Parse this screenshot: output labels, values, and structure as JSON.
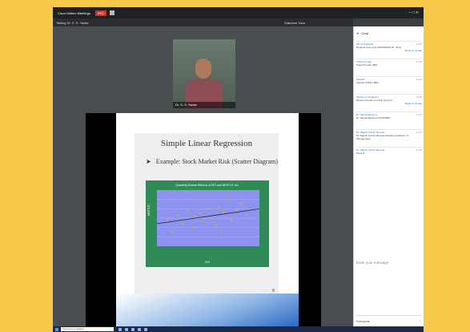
{
  "app": {
    "brand": "Cisco Webex Meetings",
    "rec_label": "REC",
    "window_controls": "– □ ✕"
  },
  "meeting": {
    "title": "Talking Dr. S. S. Yadav",
    "view_mode": "Standard View"
  },
  "video": {
    "participant_name": "Dr. S. S. Yadav"
  },
  "slide": {
    "title": "Simple Linear Regression",
    "bullet": "Example: Stock Market Risk (Scatter Diagram)",
    "page_number": "9"
  },
  "chart_data": {
    "type": "scatter",
    "title": "Quarterly Excess Returns of NYI and NESTLE, Inc.",
    "xlabel": "NYI",
    "ylabel": "NESTLE",
    "xlim": [
      -0.2,
      0.2
    ],
    "ylim": [
      -0.3,
      0.3
    ],
    "grid": true,
    "series": [
      {
        "points": [
          [
            -0.16,
            -0.02
          ],
          [
            -0.12,
            0.03
          ],
          [
            -0.1,
            -0.06
          ],
          [
            -0.08,
            0.08
          ],
          [
            -0.06,
            -0.1
          ],
          [
            -0.05,
            0.02
          ],
          [
            -0.03,
            0.05
          ],
          [
            -0.02,
            -0.04
          ],
          [
            0.0,
            0.1
          ],
          [
            0.01,
            0.0
          ],
          [
            0.03,
            -0.08
          ],
          [
            0.04,
            0.12
          ],
          [
            0.06,
            0.06
          ],
          [
            0.07,
            0.2
          ],
          [
            0.09,
            -0.02
          ],
          [
            0.11,
            0.09
          ],
          [
            0.13,
            0.16
          ],
          [
            0.15,
            0.04
          ],
          [
            -0.14,
            -0.14
          ],
          [
            0.05,
            -0.16
          ]
        ]
      }
    ],
    "trendline": {
      "x": [
        -0.2,
        0.2
      ],
      "y": [
        -0.06,
        0.1
      ]
    }
  },
  "chat": {
    "header": "Chat",
    "messages": [
      {
        "from": "Me to Organizer",
        "text": "Regards to be sent (02/02/2021) Dr. Vinay",
        "time": "10:02"
      },
      {
        "from": "Prachi Kumari",
        "text": "Prachi Kumari, BBA",
        "time": "10:05"
      },
      {
        "from": "Kanishk",
        "text": "Kanishk 24616, BBA",
        "time": "10:06"
      },
      {
        "from": "Muskan to Organizer",
        "text": "Muskan Kumari (not fully present)",
        "time": "10:08"
      },
      {
        "from": "Dr. Sapna Mousumi",
        "text": "Dr. Sapna Mousumi 24153 BBA",
        "time": "10:12"
      },
      {
        "from": "Dr. Rajesh Kumar Sharma",
        "text": "Dr. Rajesh Kumar Sharma Assistant professor of Management",
        "time": "10:15"
      },
      {
        "from": "Dr. Rajesh Kumar Sharma",
        "text": "Present",
        "time": "10:18"
      }
    ],
    "reply_label": "Reply to private",
    "input_placeholder": "Enter your message",
    "send_to": "Everyone"
  },
  "taskbar": {
    "search_placeholder": "Type here to search"
  }
}
